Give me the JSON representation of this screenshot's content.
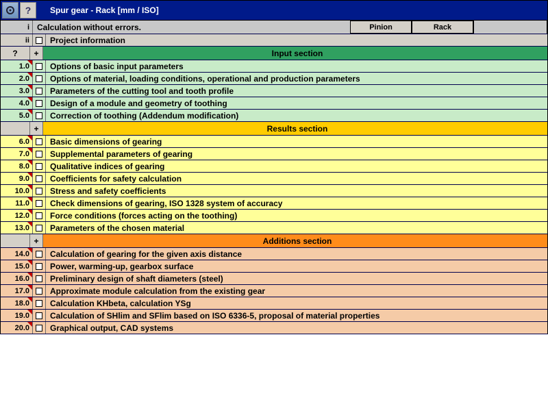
{
  "title": "Spur gear - Rack [mm / ISO]",
  "status_row": {
    "num": "i",
    "text": "Calculation without errors."
  },
  "project_row": {
    "num": "ii",
    "text": "Project information"
  },
  "tabs": {
    "pinion": "Pinion",
    "rack": "Rack"
  },
  "sections": {
    "input": {
      "qmark": "?",
      "plus": "+",
      "title": "Input section"
    },
    "results": {
      "plus": "+",
      "title": "Results section"
    },
    "additions": {
      "plus": "+",
      "title": "Additions section"
    }
  },
  "input_rows": [
    {
      "num": "1.0",
      "text": "Options of basic input parameters"
    },
    {
      "num": "2.0",
      "text": "Options of material, loading conditions, operational and production parameters"
    },
    {
      "num": "3.0",
      "text": "Parameters of the cutting tool and tooth profile"
    },
    {
      "num": "4.0",
      "text": "Design of a module and geometry of toothing"
    },
    {
      "num": "5.0",
      "text": "Correction of toothing (Addendum modification)"
    }
  ],
  "results_rows": [
    {
      "num": "6.0",
      "text": "Basic dimensions of gearing"
    },
    {
      "num": "7.0",
      "text": "Supplemental parameters of gearing"
    },
    {
      "num": "8.0",
      "text": "Qualitative indices of gearing"
    },
    {
      "num": "9.0",
      "text": "Coefficients for safety calculation"
    },
    {
      "num": "10.0",
      "text": "Stress and safety coefficients"
    },
    {
      "num": "11.0",
      "text": "Check dimensions of gearing, ISO 1328 system of accuracy"
    },
    {
      "num": "12.0",
      "text": "Force conditions (forces acting on the toothing)"
    },
    {
      "num": "13.0",
      "text": "Parameters of the chosen material"
    }
  ],
  "additions_rows": [
    {
      "num": "14.0",
      "text": "Calculation of gearing for the given axis distance"
    },
    {
      "num": "15.0",
      "text": "Power, warming-up, gearbox surface"
    },
    {
      "num": "16.0",
      "text": "Preliminary design of shaft diameters (steel)"
    },
    {
      "num": "17.0",
      "text": "Approximate module calculation from the existing gear"
    },
    {
      "num": "18.0",
      "text": "Calculation KHbeta, calculation YSg"
    },
    {
      "num": "19.0",
      "text": "Calculation of SHlim and SFlim based on ISO 6336-5, proposal of material properties"
    },
    {
      "num": "20.0",
      "text": "Graphical output, CAD systems"
    }
  ]
}
